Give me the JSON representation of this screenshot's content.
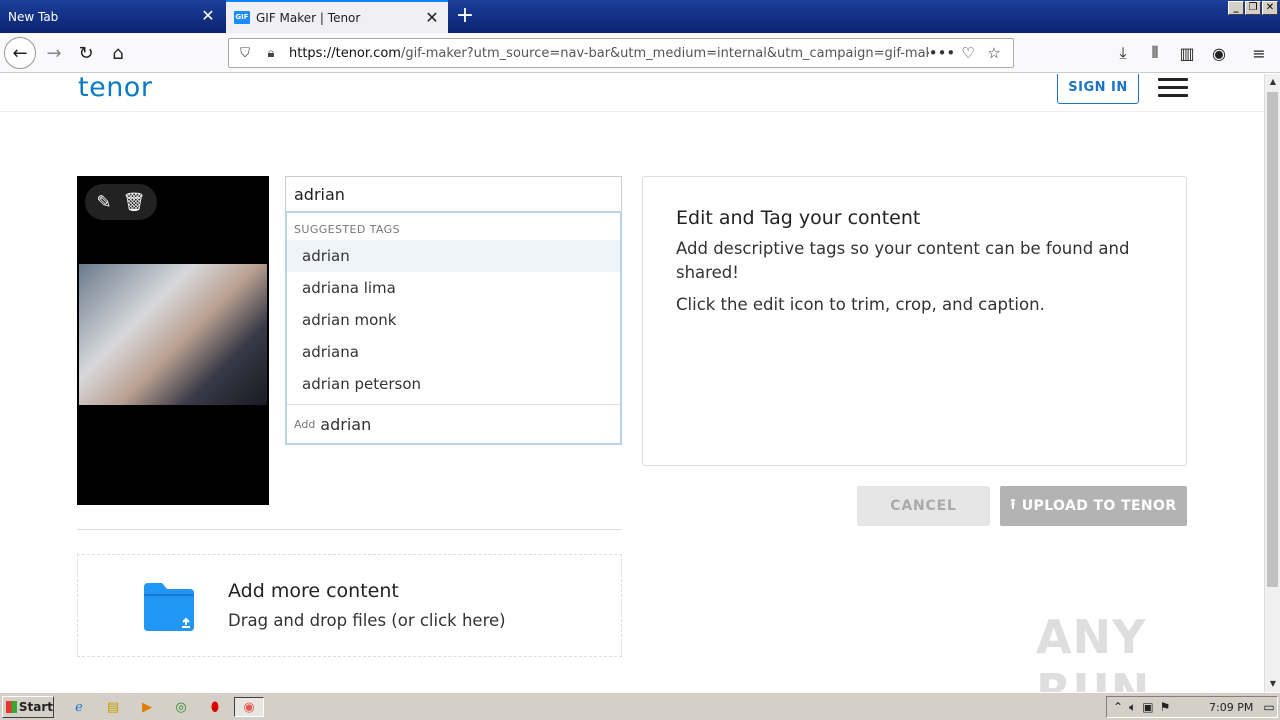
{
  "browser": {
    "tabs": [
      {
        "label": "New Tab",
        "active": false
      },
      {
        "label": "GIF Maker | Tenor",
        "active": true,
        "favicon": "GIF"
      }
    ],
    "url_host": "https://tenor.com",
    "url_path": "/gif-maker?utm_source=nav-bar&utm_medium=internal&utm_campaign=gif-maker-entrypoint"
  },
  "header": {
    "logo": "tenor",
    "sign_in_label": "SIGN IN"
  },
  "editor": {
    "tag_input_value": "adrian",
    "suggest_heading": "SUGGESTED TAGS",
    "suggestions": [
      "adrian",
      "adriana lima",
      "adrian monk",
      "adriana",
      "adrian peterson"
    ],
    "add_prefix": "Add",
    "add_value": "adrian"
  },
  "info": {
    "title": "Edit and Tag your content",
    "line1": "Add descriptive tags so your content can be found and shared!",
    "line2": "Click the edit icon to trim, crop, and caption."
  },
  "actions": {
    "cancel_label": "CANCEL",
    "upload_label": "UPLOAD TO TENOR"
  },
  "add_more": {
    "title": "Add more content",
    "subtitle": "Drag and drop files (or click here)"
  },
  "watermark": "ANY RUN",
  "taskbar": {
    "start_label": "Start",
    "clock": "7:09 PM"
  },
  "colors": {
    "brand": "#0a7bc2",
    "signin": "#1a73c8",
    "folder": "#2196f3"
  }
}
